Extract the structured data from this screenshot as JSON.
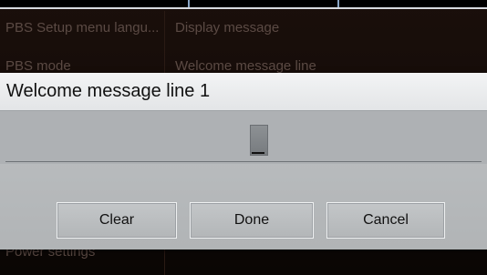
{
  "background_menu": {
    "left_items": [
      "PBS Setup menu langu...",
      "PBS mode",
      "Power settings"
    ],
    "right_items": [
      "Display message",
      "Welcome message line"
    ]
  },
  "dialog": {
    "title": "Welcome message line 1",
    "input_value": "",
    "buttons": {
      "clear": "Clear",
      "done": "Done",
      "cancel": "Cancel"
    }
  }
}
